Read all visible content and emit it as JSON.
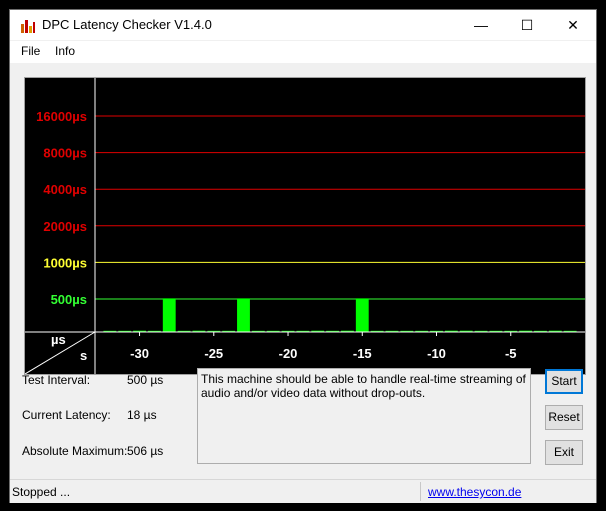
{
  "window": {
    "title": "DPC Latency Checker V1.4.0",
    "minimize": "—",
    "maximize": "☐",
    "close": "✕"
  },
  "menu": {
    "file": "File",
    "info": "Info"
  },
  "chart_data": {
    "type": "bar",
    "y_labels": [
      {
        "text": "16000µs",
        "value": 16000,
        "color": "#e00000"
      },
      {
        "text": "8000µs",
        "value": 8000,
        "color": "#e00000"
      },
      {
        "text": "4000µs",
        "value": 4000,
        "color": "#e00000"
      },
      {
        "text": "2000µs",
        "value": 2000,
        "color": "#e00000"
      },
      {
        "text": "1000µs",
        "value": 1000,
        "color": "#ffff33"
      },
      {
        "text": "500µs",
        "value": 500,
        "color": "#33ff33"
      }
    ],
    "x_ticks": [
      {
        "text": "-30",
        "value": -30
      },
      {
        "text": "-25",
        "value": -25
      },
      {
        "text": "-20",
        "value": -20
      },
      {
        "text": "-15",
        "value": -15
      },
      {
        "text": "-10",
        "value": -10
      },
      {
        "text": "-5",
        "value": -5
      }
    ],
    "corner_top": "µs",
    "corner_bottom": "s",
    "bar_color": "#00ff00",
    "x": [
      -32,
      -31,
      -30,
      -29,
      -28,
      -27,
      -26,
      -25,
      -24,
      -23,
      -22,
      -21,
      -20,
      -19,
      -18,
      -17,
      -16,
      -15,
      -14,
      -13,
      -12,
      -11,
      -10,
      -9,
      -8,
      -7,
      -6,
      -5,
      -4,
      -3,
      -2,
      -1
    ],
    "values": [
      18,
      18,
      20,
      18,
      506,
      18,
      20,
      18,
      18,
      506,
      18,
      18,
      18,
      18,
      20,
      18,
      20,
      506,
      18,
      18,
      18,
      18,
      18,
      20,
      20,
      18,
      18,
      18,
      20,
      18,
      20,
      18
    ]
  },
  "info": {
    "test_interval_label": "Test Interval:",
    "test_interval_value": "500 µs",
    "current_latency_label": "Current Latency:",
    "current_latency_value": "18 µs",
    "absolute_maximum_label": "Absolute Maximum:",
    "absolute_maximum_value": "506 µs"
  },
  "message": "This machine should be able to handle real-time streaming of audio and/or video data without drop-outs.",
  "buttons": {
    "start": "Start",
    "reset": "Reset",
    "exit": "Exit"
  },
  "status": {
    "text": "Stopped ...",
    "link": "www.thesycon.de"
  }
}
